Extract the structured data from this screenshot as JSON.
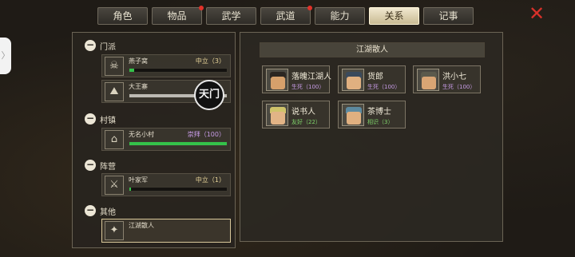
{
  "tabs": [
    {
      "label": "角色",
      "active": false,
      "dot": false
    },
    {
      "label": "物品",
      "active": false,
      "dot": true
    },
    {
      "label": "武学",
      "active": false,
      "dot": false
    },
    {
      "label": "武道",
      "active": false,
      "dot": true
    },
    {
      "label": "能力",
      "active": false,
      "dot": false
    },
    {
      "label": "关系",
      "active": true,
      "dot": false
    },
    {
      "label": "记事",
      "active": false,
      "dot": false
    }
  ],
  "close_glyph": "✕",
  "edge_tab_glyph": "〉",
  "seal_text": "天门",
  "groups": [
    {
      "title": "门派",
      "minus": "−"
    },
    {
      "title": "村镇",
      "minus": "−"
    },
    {
      "title": "阵营",
      "minus": "−"
    },
    {
      "title": "其他",
      "minus": "−"
    }
  ],
  "factions": [
    {
      "name": "燕子窝",
      "status": "中立（3）",
      "status_color": "#e8d59a",
      "fill": 0.05,
      "fill_color": "#34c24a",
      "icon": "skull-emblem-icon",
      "icon_glyph": "☠"
    },
    {
      "name": "大王寨",
      "status": "",
      "status_color": "#e8d59a",
      "fill": 1.0,
      "fill_color": "#bdbab3",
      "icon": "mountain-fort-icon",
      "icon_glyph": "⛰"
    },
    {
      "name": "无名小村",
      "status": "崇拜（100）",
      "status_color": "#c79be6",
      "fill": 1.0,
      "fill_color": "#34c24a",
      "icon": "village-house-icon",
      "icon_glyph": "⌂"
    },
    {
      "name": "叶家军",
      "status": "中立（1）",
      "status_color": "#e8d59a",
      "fill": 0.02,
      "fill_color": "#34c24a",
      "icon": "crossed-weapons-icon",
      "icon_glyph": "⚔"
    },
    {
      "name": "江湖散人",
      "status": "",
      "status_color": "#e8d59a",
      "fill": 0,
      "fill_color": "#34c24a",
      "icon": "wanderer-icon",
      "icon_glyph": "✦"
    }
  ],
  "right_title": "江湖散人",
  "characters": [
    {
      "name": "落魄江湖人",
      "relation": "生死（100）",
      "rel_color": "#c79be6",
      "hat_color": "#2b2621",
      "face_color": "#d6a06b"
    },
    {
      "name": "货郎",
      "relation": "生死（100）",
      "rel_color": "#c79be6",
      "hat_color": "#3a4a5c",
      "face_color": "#e0b080"
    },
    {
      "name": "洪小七",
      "relation": "生死（100）",
      "rel_color": "#c79be6",
      "hat_color": "#5b5a4c",
      "face_color": "#d9a574"
    },
    {
      "name": "说书人",
      "relation": "友好（22）",
      "rel_color": "#7fd36a",
      "hat_color": "#cfc36a",
      "face_color": "#e2b486"
    },
    {
      "name": "茶博士",
      "relation": "相识（3）",
      "rel_color": "#7fd36a",
      "hat_color": "#5d8aa0",
      "face_color": "#e0b080"
    }
  ]
}
